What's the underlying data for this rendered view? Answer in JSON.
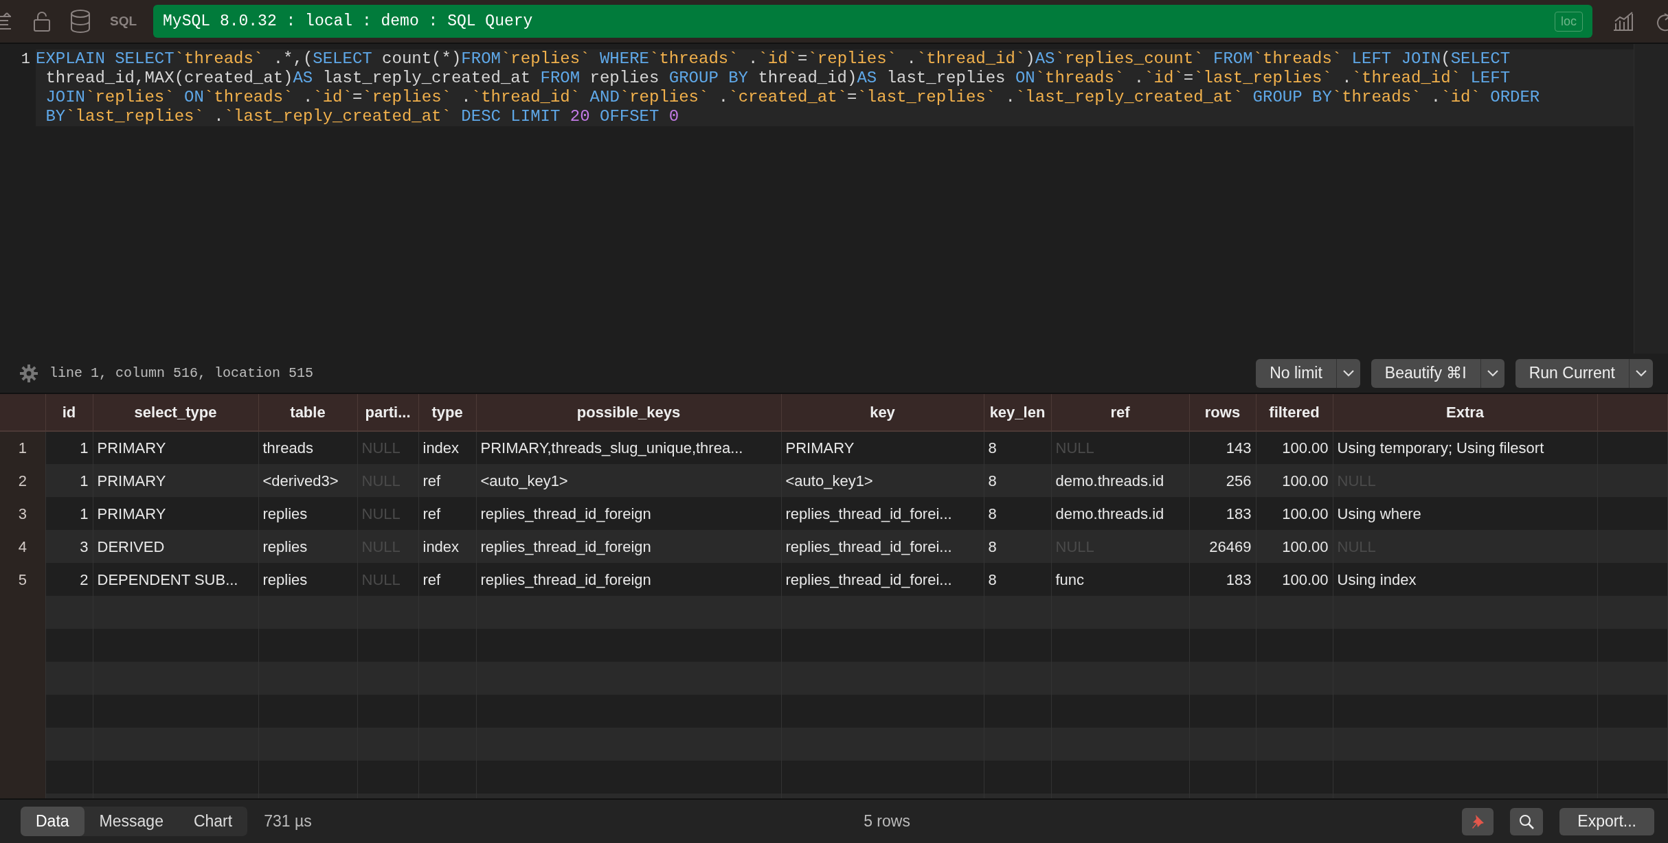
{
  "toolbar": {
    "tab_label": "SQL",
    "connection": "MySQL 8.0.32 : local : demo : SQL Query",
    "badge": "loc"
  },
  "editor": {
    "line_number": "1",
    "lines": [
      [
        {
          "kind": "kw",
          "text": "EXPLAIN SELECT"
        },
        {
          "kind": "id",
          "text": "`threads`"
        },
        {
          "kind": "plain",
          "text": " .*,("
        },
        {
          "kind": "kw",
          "text": "SELECT"
        },
        {
          "kind": "plain",
          "text": " count(*)"
        },
        {
          "kind": "kw",
          "text": "FROM"
        },
        {
          "kind": "id",
          "text": "`replies`"
        },
        {
          "kind": "kw",
          "text": " WHERE"
        },
        {
          "kind": "id",
          "text": "`threads`"
        },
        {
          "kind": "plain",
          "text": " ."
        },
        {
          "kind": "id",
          "text": "`id`"
        },
        {
          "kind": "plain",
          "text": "="
        },
        {
          "kind": "id",
          "text": "`replies`"
        },
        {
          "kind": "plain",
          "text": " ."
        },
        {
          "kind": "id",
          "text": "`thread_id`"
        },
        {
          "kind": "plain",
          "text": ")"
        },
        {
          "kind": "kw",
          "text": "AS"
        },
        {
          "kind": "id",
          "text": "`replies_count`"
        },
        {
          "kind": "kw",
          "text": " FROM"
        },
        {
          "kind": "id",
          "text": "`threads`"
        },
        {
          "kind": "kw",
          "text": " LEFT JOIN"
        },
        {
          "kind": "plain",
          "text": "("
        },
        {
          "kind": "kw",
          "text": "SELECT"
        }
      ],
      [
        {
          "kind": "plain",
          "text": " thread_id,MAX(created_at)"
        },
        {
          "kind": "kw",
          "text": "AS"
        },
        {
          "kind": "plain",
          "text": " last_reply_created_at "
        },
        {
          "kind": "kw",
          "text": "FROM"
        },
        {
          "kind": "plain",
          "text": " replies "
        },
        {
          "kind": "kw",
          "text": "GROUP BY"
        },
        {
          "kind": "plain",
          "text": " thread_id)"
        },
        {
          "kind": "kw",
          "text": "AS"
        },
        {
          "kind": "plain",
          "text": " last_replies "
        },
        {
          "kind": "kw",
          "text": "ON"
        },
        {
          "kind": "id",
          "text": "`threads`"
        },
        {
          "kind": "plain",
          "text": " ."
        },
        {
          "kind": "id",
          "text": "`id`"
        },
        {
          "kind": "plain",
          "text": "="
        },
        {
          "kind": "id",
          "text": "`last_replies`"
        },
        {
          "kind": "plain",
          "text": " ."
        },
        {
          "kind": "id",
          "text": "`thread_id`"
        },
        {
          "kind": "kw",
          "text": " LEFT"
        }
      ],
      [
        {
          "kind": "kw",
          "text": " JOIN"
        },
        {
          "kind": "id",
          "text": "`replies`"
        },
        {
          "kind": "kw",
          "text": " ON"
        },
        {
          "kind": "id",
          "text": "`threads`"
        },
        {
          "kind": "plain",
          "text": " ."
        },
        {
          "kind": "id",
          "text": "`id`"
        },
        {
          "kind": "plain",
          "text": "="
        },
        {
          "kind": "id",
          "text": "`replies`"
        },
        {
          "kind": "plain",
          "text": " ."
        },
        {
          "kind": "id",
          "text": "`thread_id`"
        },
        {
          "kind": "kw",
          "text": " AND"
        },
        {
          "kind": "id",
          "text": "`replies`"
        },
        {
          "kind": "plain",
          "text": " ."
        },
        {
          "kind": "id",
          "text": "`created_at`"
        },
        {
          "kind": "plain",
          "text": "="
        },
        {
          "kind": "id",
          "text": "`last_replies`"
        },
        {
          "kind": "plain",
          "text": " ."
        },
        {
          "kind": "id",
          "text": "`last_reply_created_at`"
        },
        {
          "kind": "kw",
          "text": " GROUP BY"
        },
        {
          "kind": "id",
          "text": "`threads`"
        },
        {
          "kind": "plain",
          "text": " ."
        },
        {
          "kind": "id",
          "text": "`id`"
        },
        {
          "kind": "kw",
          "text": " ORDER"
        }
      ],
      [
        {
          "kind": "kw",
          "text": " BY"
        },
        {
          "kind": "id",
          "text": "`last_replies`"
        },
        {
          "kind": "plain",
          "text": " ."
        },
        {
          "kind": "id",
          "text": "`last_reply_created_at`"
        },
        {
          "kind": "kw",
          "text": " DESC LIMIT "
        },
        {
          "kind": "num",
          "text": "20"
        },
        {
          "kind": "kw",
          "text": " OFFSET "
        },
        {
          "kind": "num",
          "text": "0"
        }
      ]
    ]
  },
  "status": {
    "cursor": "line 1, column 516, location 515",
    "buttons": [
      "No limit",
      "Beautify ⌘I",
      "Run Current"
    ]
  },
  "table": {
    "columns": [
      {
        "label": "id",
        "numeric": true
      },
      {
        "label": "select_type",
        "numeric": false
      },
      {
        "label": "table",
        "numeric": false
      },
      {
        "label": "parti...",
        "numeric": false
      },
      {
        "label": "type",
        "numeric": false
      },
      {
        "label": "possible_keys",
        "numeric": false
      },
      {
        "label": "key",
        "numeric": false
      },
      {
        "label": "key_len",
        "numeric": false
      },
      {
        "label": "ref",
        "numeric": false
      },
      {
        "label": "rows",
        "numeric": true
      },
      {
        "label": "filtered",
        "numeric": true
      },
      {
        "label": "Extra",
        "numeric": false
      }
    ],
    "rows": [
      {
        "number": "1",
        "cells": [
          "1",
          "PRIMARY",
          "threads",
          {
            "text": "NULL",
            "dim": true
          },
          "index",
          "PRIMARY,threads_slug_unique,threa...",
          "PRIMARY",
          "8",
          {
            "text": "NULL",
            "dim": true
          },
          "143",
          "100.00",
          "Using temporary; Using filesort"
        ]
      },
      {
        "number": "2",
        "cells": [
          "1",
          "PRIMARY",
          "<derived3>",
          {
            "text": "NULL",
            "dim": true
          },
          "ref",
          "<auto_key1>",
          "<auto_key1>",
          "8",
          "demo.threads.id",
          "256",
          "100.00",
          {
            "text": "NULL",
            "dim": true
          }
        ]
      },
      {
        "number": "3",
        "cells": [
          "1",
          "PRIMARY",
          "replies",
          {
            "text": "NULL",
            "dim": true
          },
          "ref",
          "replies_thread_id_foreign",
          "replies_thread_id_forei...",
          "8",
          "demo.threads.id",
          "183",
          "100.00",
          "Using where"
        ]
      },
      {
        "number": "4",
        "cells": [
          "3",
          "DERIVED",
          "replies",
          {
            "text": "NULL",
            "dim": true
          },
          "index",
          "replies_thread_id_foreign",
          "replies_thread_id_forei...",
          "8",
          {
            "text": "NULL",
            "dim": true
          },
          "26469",
          "100.00",
          {
            "text": "NULL",
            "dim": true
          }
        ]
      },
      {
        "number": "5",
        "cells": [
          "2",
          "DEPENDENT SUB...",
          "replies",
          {
            "text": "NULL",
            "dim": true
          },
          "ref",
          "replies_thread_id_foreign",
          "replies_thread_id_forei...",
          "8",
          "func",
          "183",
          "100.00",
          "Using index"
        ]
      }
    ]
  },
  "footer": {
    "tabs": [
      {
        "label": "Data",
        "selected": true
      },
      {
        "label": "Message",
        "selected": false
      },
      {
        "label": "Chart",
        "selected": false
      }
    ],
    "timing": "731 µs",
    "row_count": "5 rows",
    "export": "Export..."
  }
}
